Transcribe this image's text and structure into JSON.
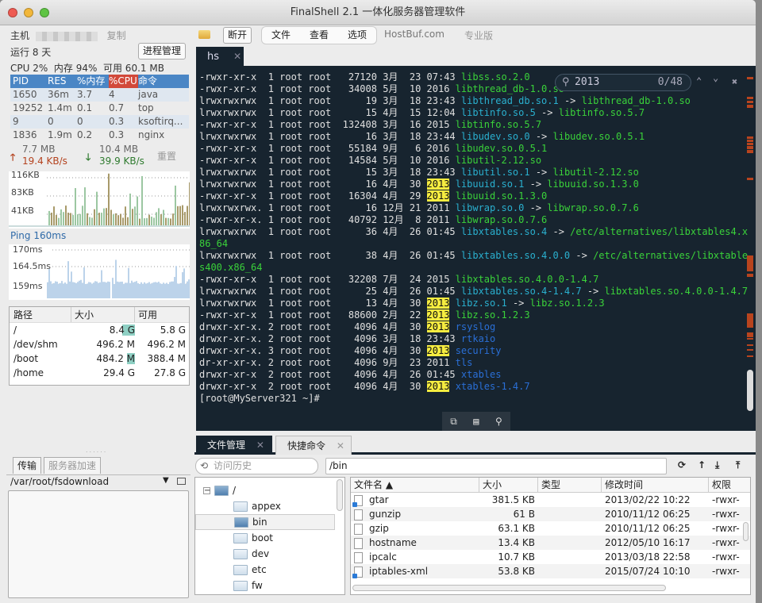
{
  "window": {
    "title": "FinalShell 2.1 一体化服务器管理软件",
    "traffic_colors": [
      "#ee5b52",
      "#f2b73a",
      "#5ec443"
    ]
  },
  "sidebar": {
    "host_label": "主机",
    "copy_label": "复制",
    "uptime": "运行 8 天",
    "process_mgr_button": "进程管理",
    "stats": "CPU 2%  内存 94%  可用 60.1 MB",
    "process_table": {
      "headers": [
        "PID",
        "RES",
        "%内存",
        "%CPU",
        "命令"
      ],
      "rows": [
        [
          "1650",
          "36m",
          "3.7",
          "4",
          "java"
        ],
        [
          "19252",
          "1.4m",
          "0.1",
          "0.7",
          "top"
        ],
        [
          "9",
          "0",
          "0",
          "0.3",
          "ksoftirq..."
        ],
        [
          "1836",
          "1.9m",
          "0.2",
          "0.3",
          "nginx"
        ]
      ]
    },
    "network": {
      "up_total": "7.7 MB",
      "up_rate": "19.4 KB/s",
      "down_total": "10.4 MB",
      "down_rate": "39.9 KB/s",
      "reset_label": "重置",
      "y_ticks": [
        "116KB",
        "83KB",
        "41KB"
      ]
    },
    "ping": {
      "label": "Ping 160ms",
      "y_ticks": [
        "170ms",
        "164.5ms",
        "159ms"
      ]
    },
    "disk_table": {
      "headers": [
        "路径",
        "大小",
        "可用"
      ],
      "rows": [
        {
          "path": "/",
          "size": "8.4 G",
          "free": "5.8 G",
          "used_fraction": 0.31
        },
        {
          "path": "/dev/shm",
          "size": "496.2 M",
          "free": "496.2 M",
          "used_fraction": 0
        },
        {
          "path": "/boot",
          "size": "484.2 M",
          "free": "388.4 M",
          "used_fraction": 0.2
        },
        {
          "path": "/home",
          "size": "29.4 G",
          "free": "27.8 G",
          "used_fraction": 0.05
        }
      ]
    },
    "bottom_tabs": [
      "传输",
      "服务器加速"
    ],
    "download_path": "/var/root/fsdownload"
  },
  "toolbar": {
    "disconnect": "断开",
    "menu": [
      "文件",
      "查看",
      "选项"
    ],
    "site": "HostBuf.com",
    "edition": "专业版"
  },
  "terminal": {
    "tab_label": "hs",
    "search": {
      "query": "2013",
      "count": "0/48"
    },
    "lines": [
      [
        [
          "w",
          "-rwxr-xr-x  1 root root   27120 3月  23 07:43 "
        ],
        [
          "g",
          "libss.so.2.0"
        ]
      ],
      [
        [
          "w",
          "-rwxr-xr-x  1 root root   34008 5月  10 2016 "
        ],
        [
          "g",
          "libthread_db-1.0.so"
        ]
      ],
      [
        [
          "w",
          "lrwxrwxrwx  1 root root      19 3月  18 23:43 "
        ],
        [
          "c",
          "libthread_db.so.1"
        ],
        [
          "w",
          " -> "
        ],
        [
          "g",
          "libthread_db-1.0.so"
        ]
      ],
      [
        [
          "w",
          "lrwxrwxrwx  1 root root      15 4月  15 12:04 "
        ],
        [
          "c",
          "libtinfo.so.5"
        ],
        [
          "w",
          " -> "
        ],
        [
          "g",
          "libtinfo.so.5.7"
        ]
      ],
      [
        [
          "w",
          "-rwxr-xr-x  1 root root  132408 3月  16 2015 "
        ],
        [
          "g",
          "libtinfo.so.5.7"
        ]
      ],
      [
        [
          "w",
          "lrwxrwxrwx  1 root root      16 3月  18 23:44 "
        ],
        [
          "c",
          "libudev.so.0"
        ],
        [
          "w",
          " -> "
        ],
        [
          "g",
          "libudev.so.0.5.1"
        ]
      ],
      [
        [
          "w",
          "-rwxr-xr-x  1 root root   55184 9月   6 2016 "
        ],
        [
          "g",
          "libudev.so.0.5.1"
        ]
      ],
      [
        [
          "w",
          "-rwxr-xr-x  1 root root   14584 5月  10 2016 "
        ],
        [
          "g",
          "libutil-2.12.so"
        ]
      ],
      [
        [
          "w",
          "lrwxrwxrwx  1 root root      15 3月  18 23:43 "
        ],
        [
          "c",
          "libutil.so.1"
        ],
        [
          "w",
          " -> "
        ],
        [
          "g",
          "libutil-2.12.so"
        ]
      ],
      [
        [
          "w",
          "lrwxrwxrwx  1 root root      16 4月  30 "
        ],
        [
          "hl",
          "2013"
        ],
        [
          "w",
          " "
        ],
        [
          "c",
          "libuuid.so.1"
        ],
        [
          "w",
          " -> "
        ],
        [
          "g",
          "libuuid.so.1.3.0"
        ]
      ],
      [
        [
          "w",
          "-rwxr-xr-x  1 root root   16304 4月  29 "
        ],
        [
          "hl",
          "2013"
        ],
        [
          "w",
          " "
        ],
        [
          "g",
          "libuuid.so.1.3.0"
        ]
      ],
      [
        [
          "w",
          "lrwxrwxrwx. 1 root root      16 12月 21 2011 "
        ],
        [
          "c",
          "libwrap.so.0"
        ],
        [
          "w",
          " -> "
        ],
        [
          "g",
          "libwrap.so.0.7.6"
        ]
      ],
      [
        [
          "w",
          "-rwxr-xr-x. 1 root root   40792 12月  8 2011 "
        ],
        [
          "g",
          "libwrap.so.0.7.6"
        ]
      ],
      [
        [
          "w",
          "lrwxrwxrwx  1 root root      36 4月  26 01:45 "
        ],
        [
          "c",
          "libxtables.so.4"
        ],
        [
          "w",
          " -> "
        ],
        [
          "g",
          "/etc/alternatives/libxtables4.x"
        ]
      ],
      [
        [
          "g",
          "86_64"
        ]
      ],
      [
        [
          "w",
          "lrwxrwxrwx  1 root root      38 4月  26 01:45 "
        ],
        [
          "c",
          "libxtables.so.4.0.0"
        ],
        [
          "w",
          " -> "
        ],
        [
          "g",
          "/etc/alternatives/libxtable"
        ]
      ],
      [
        [
          "g",
          "s400.x86_64"
        ]
      ],
      [
        [
          "w",
          "-rwxr-xr-x  1 root root   32208 7月  24 2015 "
        ],
        [
          "g",
          "libxtables.so.4.0.0-1.4.7"
        ]
      ],
      [
        [
          "w",
          "lrwxrwxrwx  1 root root      25 4月  26 01:45 "
        ],
        [
          "c",
          "libxtables.so.4-1.4.7"
        ],
        [
          "w",
          " -> "
        ],
        [
          "g",
          "libxtables.so.4.0.0-1.4.7"
        ]
      ],
      [
        [
          "w",
          "lrwxrwxrwx  1 root root      13 4月  30 "
        ],
        [
          "hl",
          "2013"
        ],
        [
          "w",
          " "
        ],
        [
          "c",
          "libz.so.1"
        ],
        [
          "w",
          " -> "
        ],
        [
          "g",
          "libz.so.1.2.3"
        ]
      ],
      [
        [
          "w",
          "-rwxr-xr-x  1 root root   88600 2月  22 "
        ],
        [
          "hl",
          "2013"
        ],
        [
          "w",
          " "
        ],
        [
          "g",
          "libz.so.1.2.3"
        ]
      ],
      [
        [
          "w",
          "drwxr-xr-x. 2 root root    4096 4月  30 "
        ],
        [
          "hl",
          "2013"
        ],
        [
          "w",
          " "
        ],
        [
          "b",
          "rsyslog"
        ]
      ],
      [
        [
          "w",
          "drwxr-xr-x. 2 root root    4096 3月  18 23:43 "
        ],
        [
          "b",
          "rtkaio"
        ]
      ],
      [
        [
          "w",
          "drwxr-xr-x. 3 root root    4096 4月  30 "
        ],
        [
          "hl",
          "2013"
        ],
        [
          "w",
          " "
        ],
        [
          "b",
          "security"
        ]
      ],
      [
        [
          "w",
          "dr-xr-xr-x. 2 root root    4096 9月  23 2011 "
        ],
        [
          "b",
          "tls"
        ]
      ],
      [
        [
          "w",
          "drwxr-xr-x  2 root root    4096 4月  26 01:45 "
        ],
        [
          "b",
          "xtables"
        ]
      ],
      [
        [
          "w",
          "drwxr-xr-x  2 root root    4096 4月  30 "
        ],
        [
          "hl",
          "2013"
        ],
        [
          "w",
          " "
        ],
        [
          "b",
          "xtables-1.4.7"
        ]
      ],
      [
        [
          "w",
          "[root@MyServer321 ~]#"
        ]
      ]
    ],
    "colors": {
      "bg": "#17242f",
      "green": "#3ad23a",
      "cyan": "#2ab0cf",
      "blue": "#2a6fd6",
      "highlight": "#f5ec40",
      "marker": "#b8441e"
    }
  },
  "file_manager": {
    "tabs": [
      "文件管理",
      "快捷命令"
    ],
    "history_placeholder": "访问历史",
    "path": "/bin",
    "tree": [
      {
        "name": "/",
        "level": 0,
        "selected": false
      },
      {
        "name": "appex",
        "level": 1,
        "selected": false
      },
      {
        "name": "bin",
        "level": 1,
        "selected": true
      },
      {
        "name": "boot",
        "level": 1,
        "selected": false
      },
      {
        "name": "dev",
        "level": 1,
        "selected": false
      },
      {
        "name": "etc",
        "level": 1,
        "selected": false
      },
      {
        "name": "fw",
        "level": 1,
        "selected": false
      }
    ],
    "headers": [
      "文件名 ▲",
      "大小",
      "类型",
      "修改时间",
      "权限"
    ],
    "files": [
      {
        "name": "gtar",
        "size": "381.5 KB",
        "type": "",
        "mtime": "2013/02/22 10:22",
        "perm": "-rwxr-",
        "link": true
      },
      {
        "name": "gunzip",
        "size": "61 B",
        "type": "",
        "mtime": "2010/11/12 06:25",
        "perm": "-rwxr-",
        "link": false
      },
      {
        "name": "gzip",
        "size": "63.1 KB",
        "type": "",
        "mtime": "2010/11/12 06:25",
        "perm": "-rwxr-",
        "link": false
      },
      {
        "name": "hostname",
        "size": "13.4 KB",
        "type": "",
        "mtime": "2012/05/10 16:17",
        "perm": "-rwxr-",
        "link": false
      },
      {
        "name": "ipcalc",
        "size": "10.7 KB",
        "type": "",
        "mtime": "2013/03/18 22:58",
        "perm": "-rwxr-",
        "link": false
      },
      {
        "name": "iptables-xml",
        "size": "53.8 KB",
        "type": "",
        "mtime": "2015/07/24 10:10",
        "perm": "-rwxr-",
        "link": true
      }
    ]
  }
}
